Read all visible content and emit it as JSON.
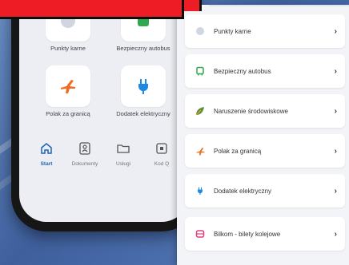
{
  "colors": {
    "accent_blue": "#1b64b4",
    "red_bar": "#ee1c24",
    "orange_plane": "#f06a21",
    "green_bus": "#2fa84f",
    "plug_blue": "#1e88e5",
    "ticket_pink": "#e43d7a"
  },
  "phone": {
    "tiles": [
      {
        "label": "Punkty karne",
        "icon": "points-icon"
      },
      {
        "label": "Bezpieczny autobus",
        "icon": "bus-icon"
      },
      {
        "label": "Polak za granicą",
        "icon": "plane-icon"
      },
      {
        "label": "Dodatek elektryczny",
        "icon": "plug-icon"
      }
    ],
    "tabs": [
      {
        "label": "Start",
        "icon": "home-icon",
        "active": true
      },
      {
        "label": "Dokumenty",
        "icon": "id-card-icon"
      },
      {
        "label": "Usługi",
        "icon": "folder-icon"
      },
      {
        "label": "Kod Q",
        "icon": "qr-icon"
      }
    ]
  },
  "list": {
    "items": [
      {
        "label": "Punkty karne",
        "icon": "points-icon"
      },
      {
        "label": "Bezpieczny autobus",
        "icon": "bus-icon"
      },
      {
        "label": "Naruszenie środowiskowe",
        "icon": "leaf-icon"
      },
      {
        "label": "Polak za granicą",
        "icon": "plane-icon"
      },
      {
        "label": "Dodatek elektryczny",
        "icon": "plug-icon"
      },
      {
        "label": "Bilkom - bilety kolejowe",
        "icon": "ticket-icon"
      }
    ],
    "chevron": "›"
  }
}
